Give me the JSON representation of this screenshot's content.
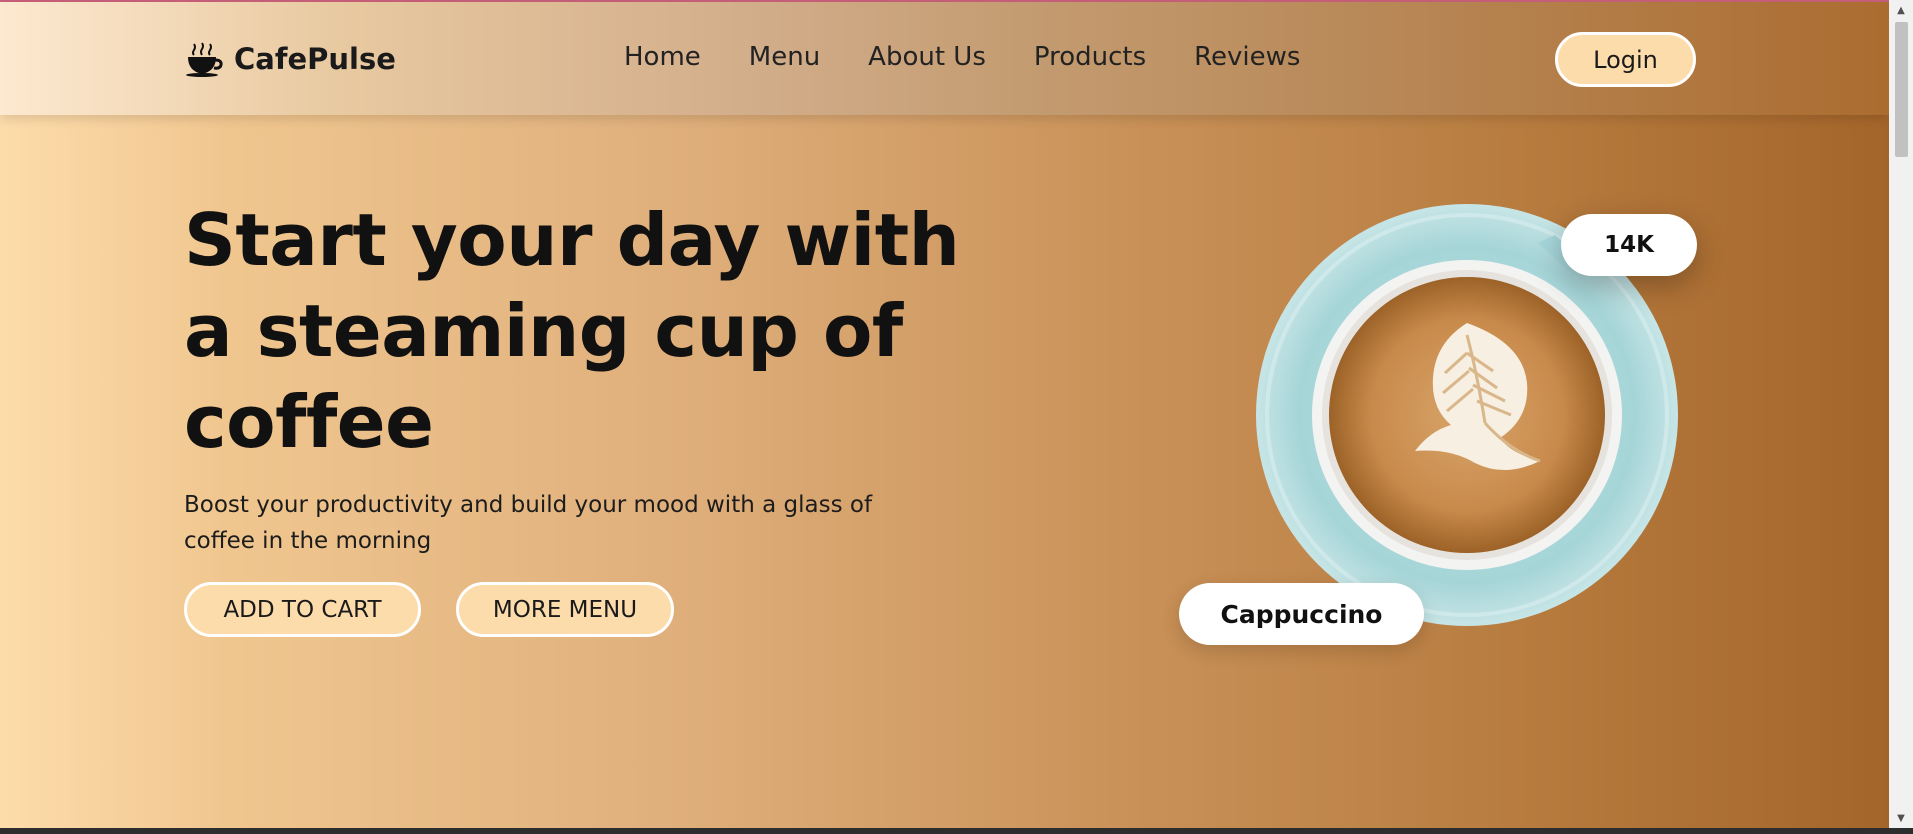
{
  "brand": {
    "name": "CafePulse",
    "logo_icon": "coffee-cup-icon"
  },
  "nav": {
    "items": [
      {
        "label": "Home"
      },
      {
        "label": "Menu"
      },
      {
        "label": "About Us"
      },
      {
        "label": "Products"
      },
      {
        "label": "Reviews"
      }
    ],
    "login_label": "Login"
  },
  "hero": {
    "headline": "Start your day with a steaming cup of coffee",
    "subtitle": "Boost your productivity and build your mood with a glass of coffee in the morning",
    "add_to_cart_label": "ADD TO CART",
    "more_menu_label": "MORE MENU"
  },
  "product": {
    "image": "cappuccino-cup-image",
    "count_badge": "14K",
    "name_badge": "Cappuccino"
  },
  "colors": {
    "gradient_start": "#fddcab",
    "gradient_end": "#a4652a",
    "button_fill": "#fddcab",
    "text": "#111111",
    "saucer": "#a8d8dc"
  }
}
